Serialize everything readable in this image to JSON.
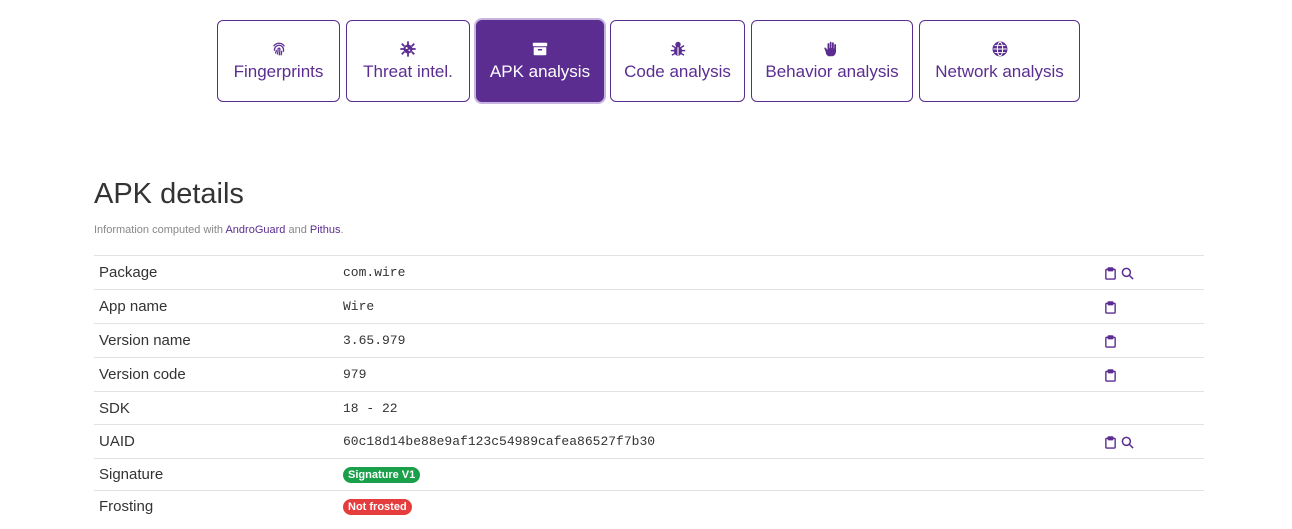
{
  "tabs": [
    {
      "label": "Fingerprints",
      "icon": "fingerprint-icon"
    },
    {
      "label": "Threat intel.",
      "icon": "virus-icon"
    },
    {
      "label": "APK analysis",
      "icon": "archive-icon",
      "active": true
    },
    {
      "label": "Code analysis",
      "icon": "bug-icon"
    },
    {
      "label": "Behavior analysis",
      "icon": "hand-icon"
    },
    {
      "label": "Network analysis",
      "icon": "globe-icon"
    }
  ],
  "section": {
    "title": "APK details",
    "subtitle_prefix": "Information computed with ",
    "link1": "AndroGuard",
    "conj": " and ",
    "link2": "Pithus",
    "suffix": "."
  },
  "rows": [
    {
      "key": "Package",
      "value": "com.wire"
    },
    {
      "key": "App name",
      "value": "Wire"
    },
    {
      "key": "Version name",
      "value": "3.65.979"
    },
    {
      "key": "Version code",
      "value": "979"
    },
    {
      "key": "SDK",
      "value": "18 - 22"
    },
    {
      "key": "UAID",
      "value": "60c18d14be88e9af123c54989cafea86527f7b30"
    },
    {
      "key": "Signature",
      "value": "Signature V1"
    },
    {
      "key": "Frosting",
      "value": "Not frosted"
    }
  ],
  "colors": {
    "accent": "#5b2d91",
    "badge_green": "#1aa04a",
    "badge_red": "#e53d3d"
  }
}
